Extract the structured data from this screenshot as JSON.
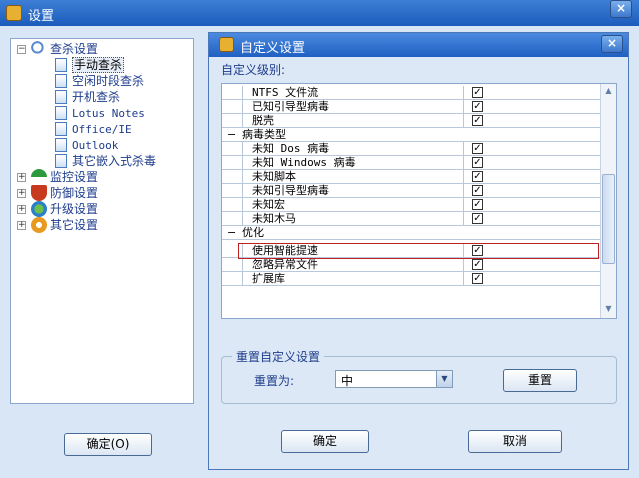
{
  "window": {
    "title": "设置",
    "close": "×"
  },
  "tree": {
    "root": {
      "label": "查杀设置",
      "expander": "⊟"
    },
    "children": [
      {
        "label": "手动查杀",
        "selected": true
      },
      {
        "label": "空闲时段查杀"
      },
      {
        "label": "开机查杀"
      },
      {
        "label": "Lotus Notes"
      },
      {
        "label": "Office/IE"
      },
      {
        "label": "Outlook"
      },
      {
        "label": "其它嵌入式杀毒"
      }
    ],
    "others": [
      {
        "label": "监控设置",
        "icon": "umbrella-icon"
      },
      {
        "label": "防御设置",
        "icon": "shield-icon"
      },
      {
        "label": "升级设置",
        "icon": "globe-icon"
      },
      {
        "label": "其它设置",
        "icon": "gear-icon"
      }
    ],
    "expander_plus": "+"
  },
  "footer": {
    "ok": "确定(O)"
  },
  "dialog": {
    "title": "自定义设置",
    "close": "×",
    "level_label": "自定义级别:",
    "check_mark": "✓",
    "group_minus": "−",
    "rows": {
      "r0": "NTFS 文件流",
      "r1": "已知引导型病毒",
      "r2": "脱壳",
      "g1": "病毒类型",
      "r3": "未知 Dos 病毒",
      "r4": "未知 Windows 病毒",
      "r5": "未知脚本",
      "r6": "未知引导型病毒",
      "r7": "未知宏",
      "r8": "未知木马",
      "g2": "优化",
      "r9": "使用智能提速",
      "r10": "忽略异常文件",
      "r11": "扩展库"
    },
    "reset": {
      "legend": "重置自定义设置",
      "label": "重置为:",
      "value": "中",
      "button": "重置"
    },
    "ok": "确定",
    "cancel": "取消"
  }
}
